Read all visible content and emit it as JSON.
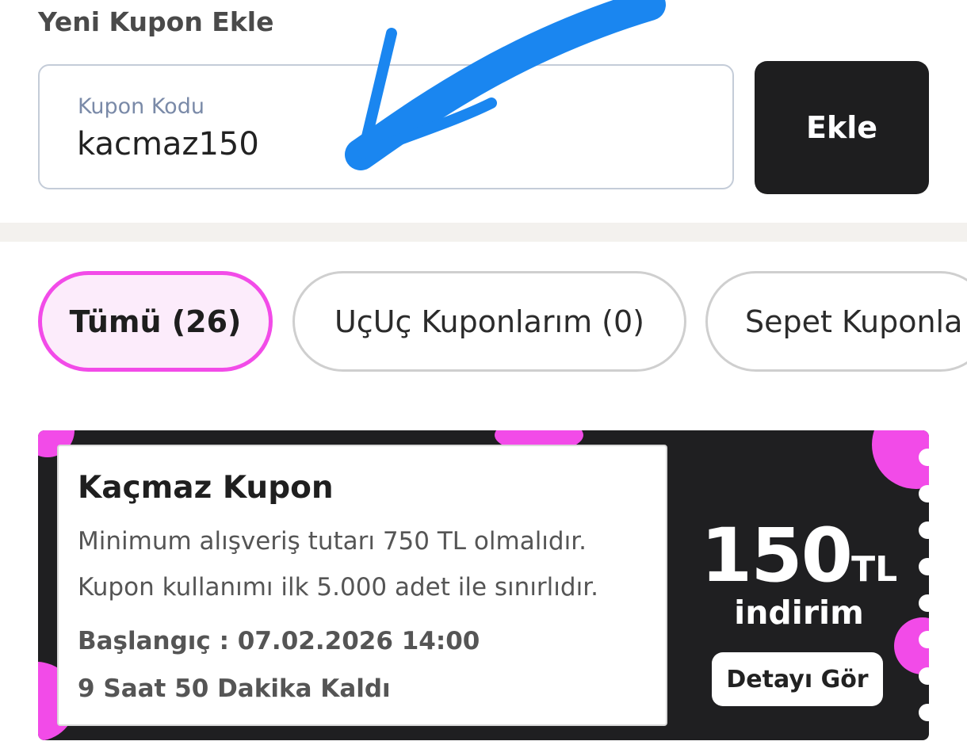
{
  "add_coupon": {
    "title": "Yeni Kupon Ekle",
    "field_label": "Kupon Kodu",
    "field_value": "kacmaz150",
    "button_label": "Ekle"
  },
  "tabs": [
    {
      "label": "Tümü (26)",
      "active": true
    },
    {
      "label": "UçUç Kuponlarım (0)",
      "active": false
    },
    {
      "label": "Sepet Kuponla",
      "active": false
    }
  ],
  "coupon": {
    "title": "Kaçmaz Kupon",
    "description_1": "Minimum alışveriş tutarı 750 TL olmalıdır.",
    "description_2": "Kupon kullanımı ilk 5.000 adet ile sınırlıdır.",
    "start": "Başlangıç : 07.02.2026 14:00",
    "remaining": "9 Saat 50 Dakika Kaldı",
    "amount": "150",
    "currency": "TL",
    "discount_label": "indirim",
    "details_button": "Detayı Gör"
  },
  "colors": {
    "accent_pink": "#f24be8",
    "card_dark": "#1f1f21",
    "button_dark": "#1e1e1f",
    "annotation_blue": "#1a86f0"
  },
  "icons": {
    "annotation": "arrow-annotation-icon"
  }
}
